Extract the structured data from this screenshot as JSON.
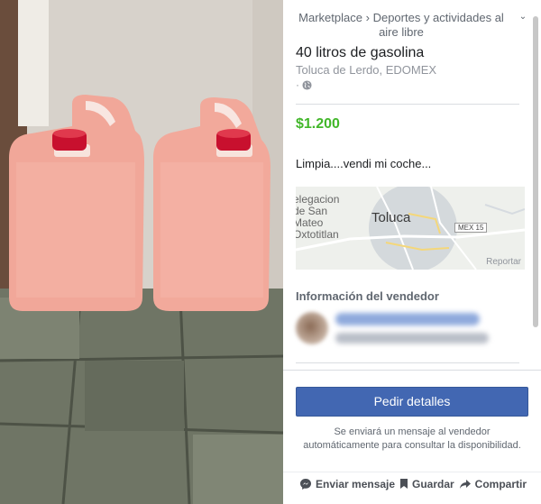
{
  "breadcrumb": {
    "root": "Marketplace",
    "separator": "›",
    "category": "Deportes y actividades al aire libre"
  },
  "listing": {
    "title": "40 litros de gasolina",
    "location": "Toluca de Lerdo, EDOMEX",
    "privacy_dot": "·",
    "price": "$1.200",
    "description": "Limpia....vendi mi coche..."
  },
  "map": {
    "city": "Toluca",
    "district_label": "elegacion\nde San\nMateo\nOxtotitlan",
    "road_badge": "MEX 15",
    "report_link": "Reportar"
  },
  "seller": {
    "section_title": "Información del vendedor"
  },
  "footer": {
    "cta_label": "Pedir detalles",
    "cta_note": "Se enviará un mensaje al vendedor automáticamente para consultar la disponibilidad.",
    "actions": [
      {
        "label": "Enviar mensaje",
        "icon": "messenger-icon"
      },
      {
        "label": "Guardar",
        "icon": "bookmark-icon"
      },
      {
        "label": "Compartir",
        "icon": "share-icon"
      }
    ]
  },
  "colors": {
    "price": "#42b72a",
    "cta_bg": "#4267b2",
    "cap": "#c8102e"
  }
}
